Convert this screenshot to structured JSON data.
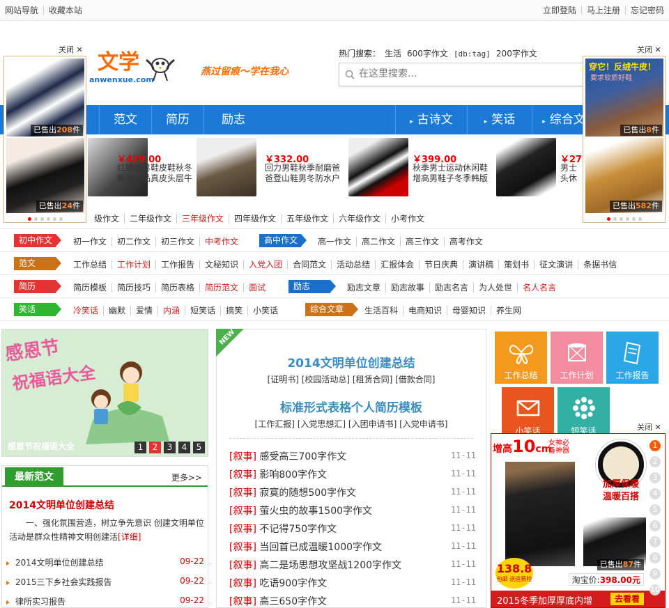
{
  "topbar": {
    "left": [
      "网站导航",
      "收藏本站"
    ],
    "right": [
      "立即登陆",
      "马上注册",
      "忘记密码"
    ]
  },
  "logo": {
    "text": "文学",
    "url": "anwenxue.com",
    "slogan": "燕过留痕～学在我心"
  },
  "search": {
    "hot_label": "热门搜索：",
    "hot_terms": [
      "生活",
      "600字作文",
      "[db:tag]",
      "200字作文"
    ],
    "placeholder": "在这里搜索..."
  },
  "nav": {
    "items": [
      "范文",
      "简历",
      "励志"
    ],
    "right_items": [
      "古诗文",
      "笑话",
      "综合文"
    ]
  },
  "products": [
    {
      "price": "￥439.00",
      "desc": "红蜻蜓男鞋皮鞋秋冬新款正品真皮头层牛皮商务休闲大码皮鞋"
    },
    {
      "price": "￥332.00",
      "desc": "回力男鞋秋季耐磨爸爸登山鞋男冬防水户外休闲鞋运动鞋老北"
    },
    {
      "price": "￥399.00",
      "desc": "秋季男士运动休闲鞋增高男鞋子冬季韩版板鞋学生阿甘跑"
    },
    {
      "price": "￥27",
      "desc": "男士头休闲鞋礼貌鞋"
    }
  ],
  "categories": [
    {
      "tag": "",
      "links": [
        "级作文",
        "二年级作文",
        "三年级作文",
        "四年级作文",
        "五年级作文",
        "六年级作文",
        "小考作文"
      ]
    },
    {
      "tag": "初中作文",
      "links": [
        "初一作文",
        "初二作文",
        "初三作文",
        "中考作文"
      ],
      "tag2": "高中作文",
      "links2": [
        "高一作文",
        "高二作文",
        "高三作文",
        "高考作文"
      ]
    },
    {
      "tag": "范文",
      "links": [
        "工作总结",
        "工作计划",
        "工作报告",
        "文秘知识",
        "入党入团",
        "合同范文",
        "活动总结",
        "汇报体会",
        "节日庆典",
        "演讲稿",
        "策划书",
        "征文演讲",
        "条据书信"
      ]
    },
    {
      "tag": "简历",
      "links": [
        "简历模板",
        "简历技巧",
        "简历表格",
        "简历范文",
        "面试"
      ],
      "tag2": "励志",
      "links2": [
        "励志文章",
        "励志故事",
        "励志名言",
        "为人处世",
        "名人名言"
      ]
    },
    {
      "tag": "笑话",
      "links": [
        "冷笑话",
        "幽默",
        "爱情",
        "内涵",
        "短笑话",
        "搞笑",
        "小笑话"
      ],
      "tag2": "综合文章",
      "links2": [
        "生活百科",
        "电商知识",
        "母婴知识",
        "养生网"
      ]
    }
  ],
  "banner": {
    "title1": "感恩节",
    "title2": "祝福语大全",
    "caption": "感恩节祝福语大全",
    "pages": [
      "1",
      "2",
      "3",
      "4",
      "5"
    ]
  },
  "latest": {
    "title": "最新范文",
    "more": "更多>>",
    "headline": "2014文明单位创建总结",
    "summary": "一、强化氛围营造，树立争先意识 创建文明单位活动是群众性精神文明创建活",
    "detail": "[详细]",
    "items": [
      {
        "text": "2014文明单位创建总结",
        "date": "09-22"
      },
      {
        "text": "2015三下乡社会实践报告",
        "date": "09-22"
      },
      {
        "text": "律所实习报告",
        "date": "09-22"
      }
    ]
  },
  "center": {
    "badge": "NEW",
    "h1": "2014文明单位创建总结",
    "sub1": "[证明书] [校园活动总] [租赁合同] [借款合同]",
    "h2": "标准形式表格个人简历模板",
    "sub2": "[工作汇报] [入党思想汇] [入团申请书] [入党申请书]",
    "articles": [
      {
        "k": "[叙事]",
        "t": "感受高三700字作文",
        "d": "11-11"
      },
      {
        "k": "[叙事]",
        "t": "影响800字作文",
        "d": "11-11"
      },
      {
        "k": "[叙事]",
        "t": "寂寞的随想500字作文",
        "d": "11-11"
      },
      {
        "k": "[叙事]",
        "t": "萤火虫的故事1500字作文",
        "d": "11-11"
      },
      {
        "k": "[叙事]",
        "t": "不记得750字作文",
        "d": "11-11"
      },
      {
        "k": "[叙事]",
        "t": "当回首已成温暖1000字作文",
        "d": "11-11"
      },
      {
        "k": "[叙事]",
        "t": "高二是场思想攻坚战1200字作文",
        "d": "11-11"
      },
      {
        "k": "[叙事]",
        "t": "吃语900字作文",
        "d": "11-11"
      },
      {
        "k": "[叙事]",
        "t": "高三650字作文",
        "d": "11-11"
      }
    ]
  },
  "tiles": [
    {
      "label": "工作总结",
      "color": "#f39a1e"
    },
    {
      "label": "工作计划",
      "color": "#f28c9e"
    },
    {
      "label": "工作报告",
      "color": "#2aa7e6"
    },
    {
      "label": "小笑话",
      "color": "#e8551f"
    },
    {
      "label": "短笑话",
      "color": "#33b0a3"
    }
  ],
  "ads": {
    "close": "关闭",
    "left": {
      "sold1": "已售出",
      "n1": "208",
      "unit": "件",
      "sold2": "已售出",
      "n2": "24"
    },
    "right": {
      "banner": "穿它！反绒牛皮！",
      "sub": "要求软质好鞋",
      "sold1": "已售出",
      "n1": "8",
      "unit": "件",
      "sold2": "已售出",
      "n2": "582"
    },
    "bottom": {
      "top1": "增高",
      "top2": "10",
      "top3": "cm",
      "brand": "女神必备神器",
      "side1": "加厚保暖",
      "side2": "温暖百搭",
      "price_big": "138.8",
      "price_note": "包邮 送运费险",
      "sold": "已售出",
      "sold_n": "87",
      "unit": "件",
      "taobao": "淘宝价:",
      "tb_price": "398.00元",
      "footer": "2015冬季加厚厚底内增",
      "cta": "去看看"
    },
    "pager": [
      "1",
      "2",
      "3",
      "4",
      "5",
      "6",
      "7",
      "8",
      "9",
      "10"
    ]
  }
}
